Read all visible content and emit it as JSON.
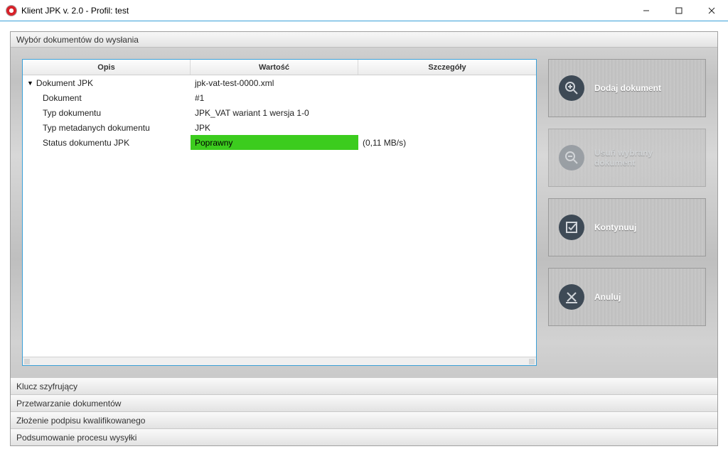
{
  "window": {
    "title": "Klient JPK v. 2.0 - Profil: test"
  },
  "section_title": "Wybór dokumentów do wysłania",
  "table": {
    "headers": {
      "opis": "Opis",
      "wartosc": "Wartość",
      "szczegoly": "Szczegóły"
    },
    "rows": [
      {
        "type": "group",
        "opis": "Dokument JPK",
        "wartosc": "jpk-vat-test-0000.xml",
        "szczegoly": ""
      },
      {
        "type": "item",
        "opis": "Dokument",
        "wartosc": "#1",
        "szczegoly": ""
      },
      {
        "type": "item",
        "opis": "Typ dokumentu",
        "wartosc": "JPK_VAT wariant 1 wersja 1-0",
        "szczegoly": ""
      },
      {
        "type": "item",
        "opis": "Typ metadanych dokumentu",
        "wartosc": "JPK",
        "szczegoly": ""
      },
      {
        "type": "item",
        "opis": "Status dokumentu JPK",
        "wartosc": "Poprawny",
        "szczegoly": "(0,11 MB/s)",
        "status": "ok"
      }
    ]
  },
  "side": {
    "add": "Dodaj dokument",
    "remove": "Usuń wybrany dokument",
    "next": "Kontynuuj",
    "cancel": "Anuluj"
  },
  "steps": [
    "Klucz szyfrujący",
    "Przetwarzanie dokumentów",
    "Złożenie podpisu kwalifikowanego",
    "Podsumowanie procesu wysyłki"
  ]
}
